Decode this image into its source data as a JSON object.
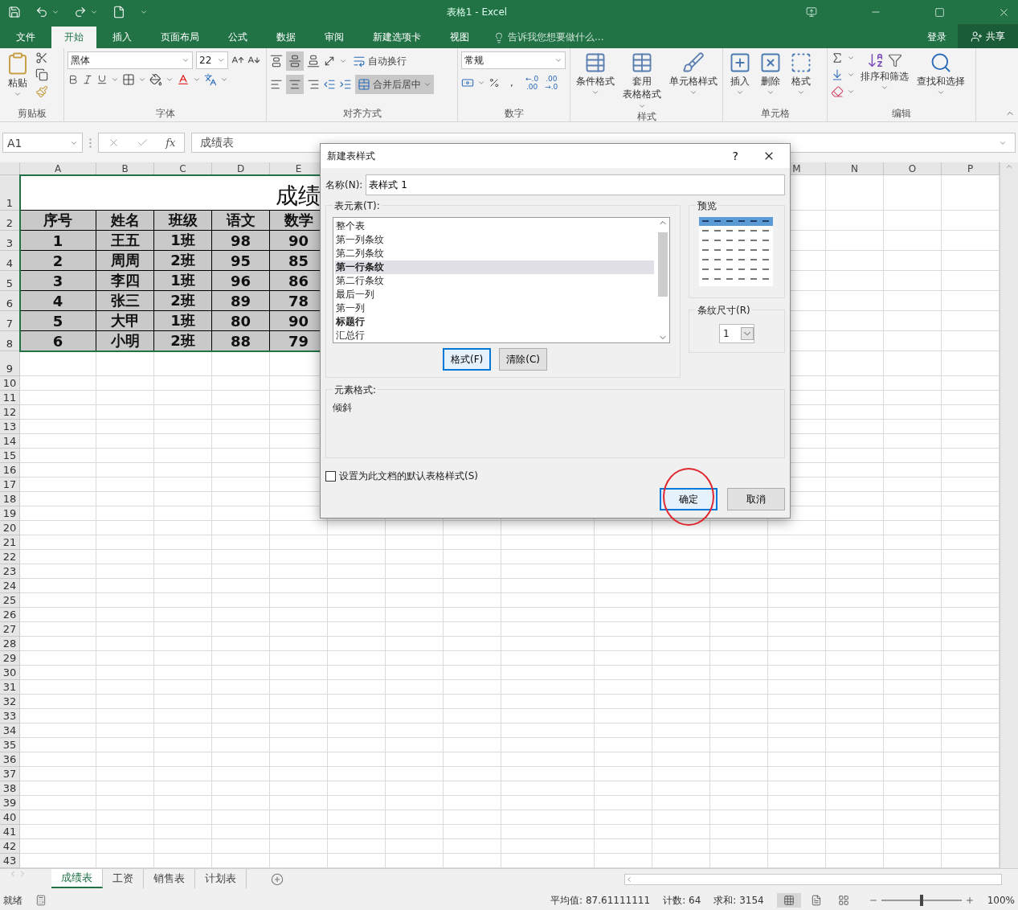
{
  "window": {
    "title": "表格1 - Excel"
  },
  "ribbon_tabs": [
    {
      "label": "文件",
      "selected": false
    },
    {
      "label": "开始",
      "selected": true
    },
    {
      "label": "插入",
      "selected": false
    },
    {
      "label": "页面布局",
      "selected": false
    },
    {
      "label": "公式",
      "selected": false
    },
    {
      "label": "数据",
      "selected": false
    },
    {
      "label": "审阅",
      "selected": false
    },
    {
      "label": "新建选项卡",
      "selected": false
    },
    {
      "label": "视图",
      "selected": false
    }
  ],
  "tell_me": "告诉我您想要做什么...",
  "sign_in": "登录",
  "share": "共享",
  "clipboard": {
    "label": "剪贴板",
    "paste": "粘贴"
  },
  "font": {
    "label": "字体",
    "name": "黑体",
    "size": "22"
  },
  "alignment": {
    "label": "对齐方式",
    "wrap_text": "自动换行",
    "merge": "合并后居中"
  },
  "number": {
    "label": "数字",
    "format": "常规",
    "comma": ",",
    "increase_decimal": [
      "←.0",
      ".00"
    ],
    "decrease_decimal": [
      ".00",
      "→.0"
    ]
  },
  "styles": {
    "label": "样式",
    "buttons": [
      [
        "条件格式"
      ],
      [
        "套用",
        "表格格式"
      ],
      [
        "单元格样式"
      ]
    ]
  },
  "cells": {
    "label": "单元格",
    "buttons": [
      "插入",
      "删除",
      "格式"
    ]
  },
  "editing": {
    "label": "编辑",
    "buttons": [
      "排序和筛选",
      "查找和选择"
    ]
  },
  "name_box": "A1",
  "fx": "fx",
  "formula": "成绩表",
  "row_headers": [
    "1",
    "2",
    "3",
    "4",
    "5",
    "6",
    "7",
    "8",
    "9",
    "10",
    "11",
    "12",
    "13",
    "14",
    "15",
    "16",
    "17",
    "18",
    "19",
    "20",
    "21",
    "22",
    "23",
    "24",
    "25",
    "26",
    "27",
    "28",
    "29",
    "30",
    "31",
    "32",
    "33",
    "34",
    "35",
    "36",
    "37",
    "38",
    "39",
    "40",
    "41",
    "42",
    "43"
  ],
  "column_headers_left": [
    "A",
    "B",
    "C",
    "D",
    "E"
  ],
  "column_headers_right": [
    "M",
    "N",
    "O",
    "P"
  ],
  "sheet": {
    "title": "成绩",
    "header": [
      "序号",
      "姓名",
      "班级",
      "语文",
      "数学"
    ],
    "rows": [
      [
        "1",
        "王五",
        "1班",
        "98",
        "90"
      ],
      [
        "2",
        "周周",
        "2班",
        "95",
        "85"
      ],
      [
        "3",
        "李四",
        "1班",
        "96",
        "86"
      ],
      [
        "4",
        "张三",
        "2班",
        "89",
        "78"
      ],
      [
        "5",
        "大甲",
        "1班",
        "80",
        "90"
      ],
      [
        "6",
        "小明",
        "2班",
        "88",
        "79"
      ]
    ]
  },
  "dialog": {
    "title": "新建表样式",
    "help": "?",
    "name_label": "名称(N):",
    "name_value": "表样式 1",
    "elements_label": "表元素(T):",
    "elements": [
      {
        "label": "整个表",
        "selected": false,
        "formatted": false
      },
      {
        "label": "第一列条纹",
        "selected": false,
        "formatted": false
      },
      {
        "label": "第二列条纹",
        "selected": false,
        "formatted": false
      },
      {
        "label": "第一行条纹",
        "selected": true,
        "formatted": true
      },
      {
        "label": "第二行条纹",
        "selected": false,
        "formatted": false
      },
      {
        "label": "最后一列",
        "selected": false,
        "formatted": false
      },
      {
        "label": "第一列",
        "selected": false,
        "formatted": false
      },
      {
        "label": "标题行",
        "selected": false,
        "formatted": true
      },
      {
        "label": "汇总行",
        "selected": false,
        "formatted": false
      }
    ],
    "format_button": "格式(F)",
    "clear_button": "清除(C)",
    "preview_label": "预览",
    "stripe_label": "条纹尺寸(R)",
    "stripe_value": "1",
    "element_format_label": "元素格式:",
    "element_format_value": "倾斜",
    "default_checkbox": {
      "label": "设置为此文档的默认表格样式(S)",
      "checked": false
    },
    "ok": "确定",
    "cancel": "取消"
  },
  "sheet_tabs": [
    {
      "label": "成绩表",
      "selected": true
    },
    {
      "label": "工资",
      "selected": false
    },
    {
      "label": "销售表",
      "selected": false
    },
    {
      "label": "计划表",
      "selected": false
    }
  ],
  "status": {
    "ready": "就绪",
    "average": "平均值: 87.61111111",
    "count": "计数: 64",
    "sum": "求和: 3154",
    "zoom": "100%",
    "zoom_slider": {
      "level": 0.5
    }
  }
}
